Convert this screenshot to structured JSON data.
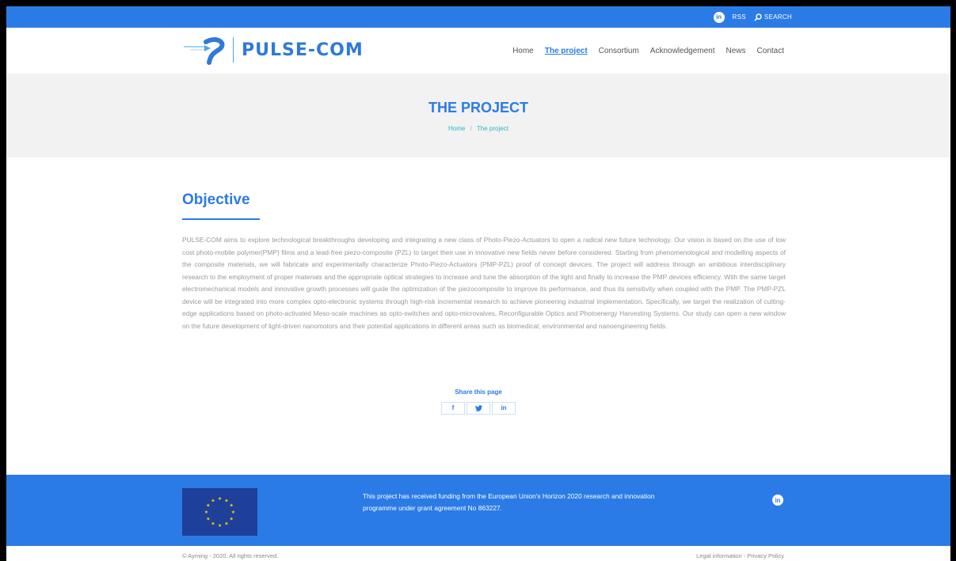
{
  "topbar": {
    "linkedin_glyph": "in",
    "rss": "RSS",
    "search": "SEARCH"
  },
  "brand": {
    "name": "PULSE-COM"
  },
  "nav": [
    "Home",
    "The project",
    "Consortium",
    "Acknowledgement",
    "News",
    "Contact"
  ],
  "nav_active": "The project",
  "hero": {
    "title": "THE PROJECT",
    "breadcrumb_home": "Home",
    "breadcrumb_sep": "/",
    "breadcrumb_current": "The project"
  },
  "content": {
    "heading": "Objective",
    "body": "PULSE-COM aims to explore technological breakthroughs developing and integrating a new class of Photo-Piezo-Actuators to open a radical new future technology. Our vision is based on the use of low cost photo-mobile polymer(PMP) films and a lead-free piezo-composite (PZL) to target their use in innovative new fields never before considered. Starting from phenomenological and modelling aspects of the composite materials, we will fabricate and experimentally characterize Photo-Piezo-Actuators (PMP-PZL) proof of concept devices. The project will address through an ambitious interdisciplinary research to the employment of proper materials and the appropriate optical strategies to increase and tune the absorption of the light and finally to increase the PMP devices efficiency. With the same target electromechanical models and innovative growth processes will guide the optimization of the piezocomposite to improve its performance, and thus its sensitivity when coupled with the PMP. The PMP-PZL device will be integrated into more complex opto-electronic systems through high-risk incremental research to achieve pioneering industrial implementation. Specifically, we target the realization of cutting-edge applications based on photo-activated Meso-scale machines as opto-switches and opto-microvalves, Reconfigurable Optics and Photoenergy Harvesting Systems. Our study can open a new window on the future development of light-driven nanomotors and their potential applications in different areas such as biomedical, environmental and nanoengineering fields."
  },
  "share": {
    "title": "Share this page",
    "facebook": "f",
    "twitter": "t",
    "linkedin": "in"
  },
  "footer": {
    "funding": "This project has received funding from the European Union's Horizon 2020 research and innovation programme under grant agreement No 863227.",
    "linkedin_glyph": "in",
    "copyright": "© Ayming - 2020. All rights reserved.",
    "legal": "Legal information - Privacy Policy"
  },
  "colors": {
    "primary": "#2b7be6",
    "accent": "#2bb5c5",
    "eu_flag": "#1e3f9a",
    "eu_stars": "#f5d300"
  }
}
